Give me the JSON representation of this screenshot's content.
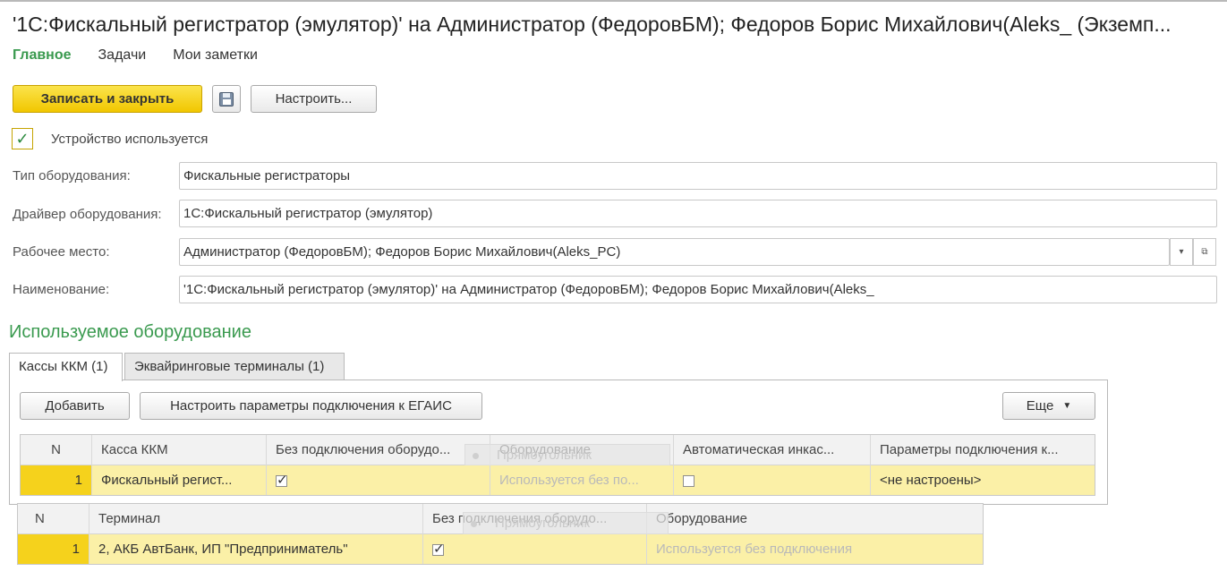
{
  "window": {
    "title": "'1С:Фискальный регистратор (эмулятор)' на Администратор (ФедоровБМ); Федоров Борис Михайлович(Aleks_ (Экземп..."
  },
  "nav": {
    "items": [
      "Главное",
      "Задачи",
      "Мои заметки"
    ]
  },
  "toolbar": {
    "save_close_label": "Записать и закрыть",
    "settings_label": "Настроить..."
  },
  "device_used": {
    "label": "Устройство используется",
    "checked": true
  },
  "fields": {
    "equipment_type": {
      "label": "Тип оборудования:",
      "value": "Фискальные регистраторы"
    },
    "driver": {
      "label": "Драйвер оборудования:",
      "value": "1С:Фискальный регистратор (эмулятор)"
    },
    "workplace": {
      "label": "Рабочее место:",
      "value": "Администратор (ФедоровБМ); Федоров Борис Михайлович(Aleks_PC)"
    },
    "name": {
      "label": "Наименование:",
      "value": "'1С:Фискальный регистратор (эмулятор)' на Администратор (ФедоровБМ); Федоров Борис Михайлович(Aleks_"
    }
  },
  "section": {
    "title": "Используемое оборудование"
  },
  "tabs": [
    {
      "label": "Кассы ККМ (1)",
      "active": true
    },
    {
      "label": "Эквайринговые терминалы (1)",
      "active": false
    }
  ],
  "cash_toolbar": {
    "add_label": "Добавить",
    "egais_label": "Настроить параметры подключения к ЕГАИС",
    "more_label": "Еще"
  },
  "cash_table": {
    "headers": [
      "N",
      "Касса ККМ",
      "Без подключения оборудо...",
      "Оборудование",
      "Автоматическая инкас...",
      "Параметры подключения к..."
    ],
    "ghost_header": "Прямоугольник",
    "rows": [
      {
        "n": "1",
        "kassa": "Фискальный регист...",
        "no_connection": true,
        "equipment": "Используется без по...",
        "auto_collection": false,
        "params": "<не настроены>"
      }
    ]
  },
  "terminal_table": {
    "headers": [
      "N",
      "Терминал",
      "Без подключения оборудо...",
      "Оборудование"
    ],
    "ghost_header": "Прямоугольник",
    "rows": [
      {
        "n": "1",
        "terminal": "2, АКБ АвтБанк, ИП \"Предприниматель\"",
        "no_connection": true,
        "equipment": "Используется без подключения"
      }
    ]
  },
  "colors": {
    "accent_green": "#3a9a4f",
    "primary_button": "#f1c700",
    "selected_row": "#fbf0a7",
    "row_number_cell": "#f5d21c"
  }
}
